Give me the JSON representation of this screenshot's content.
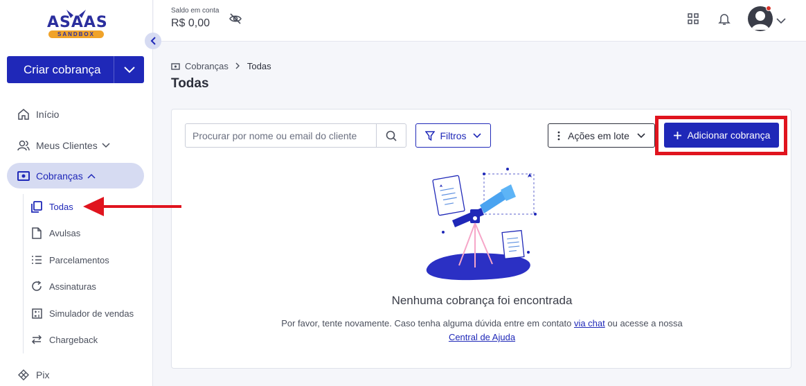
{
  "logo": {
    "word": "ASAAS",
    "badge": "SANDBOX"
  },
  "sidebar": {
    "create_label": "Criar cobrança",
    "items": [
      {
        "label": "Início"
      },
      {
        "label": "Meus Clientes"
      },
      {
        "label": "Cobranças"
      },
      {
        "label": "Pix"
      }
    ],
    "subitems": [
      {
        "label": "Todas"
      },
      {
        "label": "Avulsas"
      },
      {
        "label": "Parcelamentos"
      },
      {
        "label": "Assinaturas"
      },
      {
        "label": "Simulador de vendas"
      },
      {
        "label": "Chargeback"
      }
    ]
  },
  "topbar": {
    "saldo_label": "Saldo em conta",
    "saldo_value": "R$ 0,00"
  },
  "breadcrumb": {
    "parent": "Cobranças",
    "current": "Todas"
  },
  "page_title": "Todas",
  "toolbar": {
    "search_placeholder": "Procurar por nome ou email do cliente",
    "filters_label": "Filtros",
    "batch_label": "Ações em lote",
    "add_label": "Adicionar cobrança"
  },
  "empty": {
    "title": "Nenhuma cobrança foi encontrada",
    "text_1": "Por favor, tente novamente. Caso tenha alguma dúvida entre em contato ",
    "link_chat": "via chat",
    "text_2": " ou acesse a nossa ",
    "link_help": "Central de Ajuda"
  },
  "colors": {
    "brand": "#1f28b8",
    "highlight": "#e0141e",
    "accent": "#f0a32a"
  }
}
